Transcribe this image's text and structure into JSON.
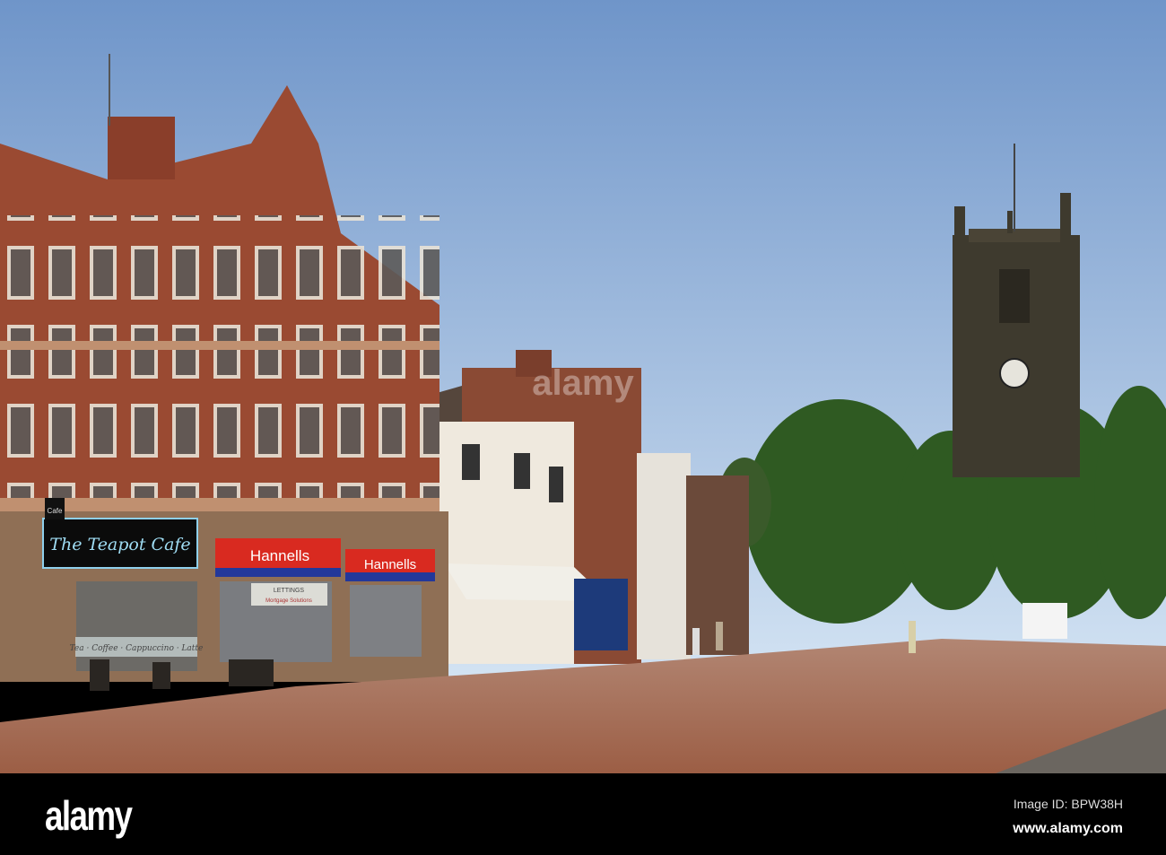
{
  "scene": {
    "cafe_small_sign": "Cafe",
    "cafe_name": "The Teapot Cafe",
    "cafe_window_text": "Tea · Coffee · Cappuccino · Latte",
    "agent_sign_1": "Hannells",
    "agent_sign_2": "Hannells",
    "agent_window_1": "LETTINGS",
    "agent_window_2": "Mortgage Solutions",
    "watermark": "alamy"
  },
  "footer": {
    "logo": "alamy",
    "image_id": "Image ID: BPW38H",
    "website": "www.alamy.com"
  },
  "colors": {
    "sky_top": "#6f95c9",
    "sky_bottom": "#cfe0f2",
    "brick": "#9a4a32",
    "pavement": "#a8765e",
    "tree": "#2f5a22"
  }
}
